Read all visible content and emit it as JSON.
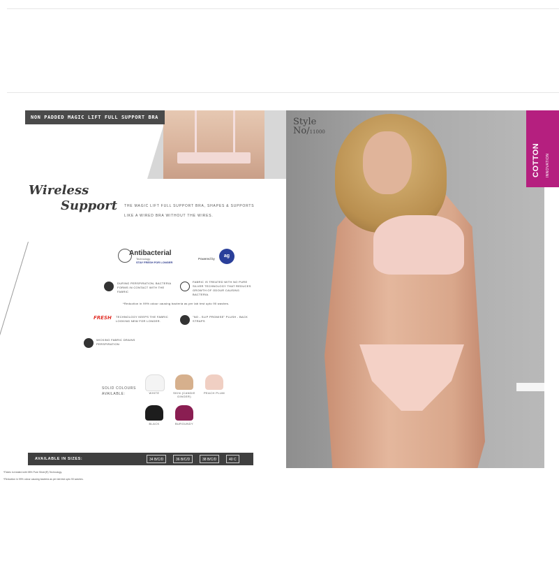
{
  "brochure": {
    "header": "NON PADDED MAGIC LIFT FULL SUPPORT BRA",
    "headline_line1": "Wireless",
    "headline_line2": "Support",
    "description": "THE MAGIC LIFT FULL SUPPORT BRA, SHAPES & SUPPORTS LIKE A WIRED BRA WITHOUT THE WIRES.",
    "antibacterial": {
      "name": "Antibacterial",
      "sub": "Technology",
      "tagline": "STAY FRESH FOR LONGER",
      "powered_by": "Powered by"
    },
    "features": [
      {
        "icon": "drops-icon",
        "text": "DURING PERSPIRATION, BACTERIA FORMS IN CONTACT WITH THE FABRIC"
      },
      {
        "icon": "no-bacteria-icon",
        "text": "FABRIC IS TREATED WITH NO PURE SILVER TECHNOLOGY THAT REDUCES GROWTH OF ODOUR CAUSING BACTERIA."
      },
      {
        "icon": "fresh-logo",
        "text": "TECHNOLOGY KEEPS THE FABRIC LOOKING NEW FOR LONGER."
      },
      {
        "icon": "strap-icon",
        "text": "\"NO - SLIP PROMISE\" PLUSH - BACK STRAPS"
      },
      {
        "icon": "fabric-icon",
        "text": "WICKING FABRIC DRAINS PERSPIRATION"
      }
    ],
    "note": "*Reduction in 99% odour causing bacteria as per lab test upto 90 washes.",
    "fresh_label": "FRESH",
    "colors_label": "SOLID COLOURS AVAILABLE:",
    "colors": [
      {
        "name": "WHITE",
        "hex": "#f4f4f4"
      },
      {
        "name": "SKIN (CANDIE GINGER)",
        "hex": "#d6b08d"
      },
      {
        "name": "PEACH PLUM",
        "hex": "#f0cfc3"
      },
      {
        "name": "BLACK",
        "hex": "#1d1d1d"
      },
      {
        "name": "BURGUNDY",
        "hex": "#8a1e52"
      }
    ],
    "sizes_label": "AVAILABLE IN SIZES:",
    "sizes": [
      "34 B/C/D",
      "36 B/C/D",
      "38 B/C/D",
      "40 C"
    ],
    "footnotes": [
      "*Fabric is treated with 98% Pure Silver(R) Technology.",
      "*Reduction in 99% odour causing bacteria as per lab test upto 90 washes."
    ]
  },
  "photo": {
    "style_label": "Style",
    "style_no_label": "No/",
    "style_number": "11000",
    "brand_line1": "COTTON",
    "brand_line2": "INNOVATION"
  },
  "colors": {
    "brand": "#b51f7f",
    "bar": "#3f3f3f"
  }
}
